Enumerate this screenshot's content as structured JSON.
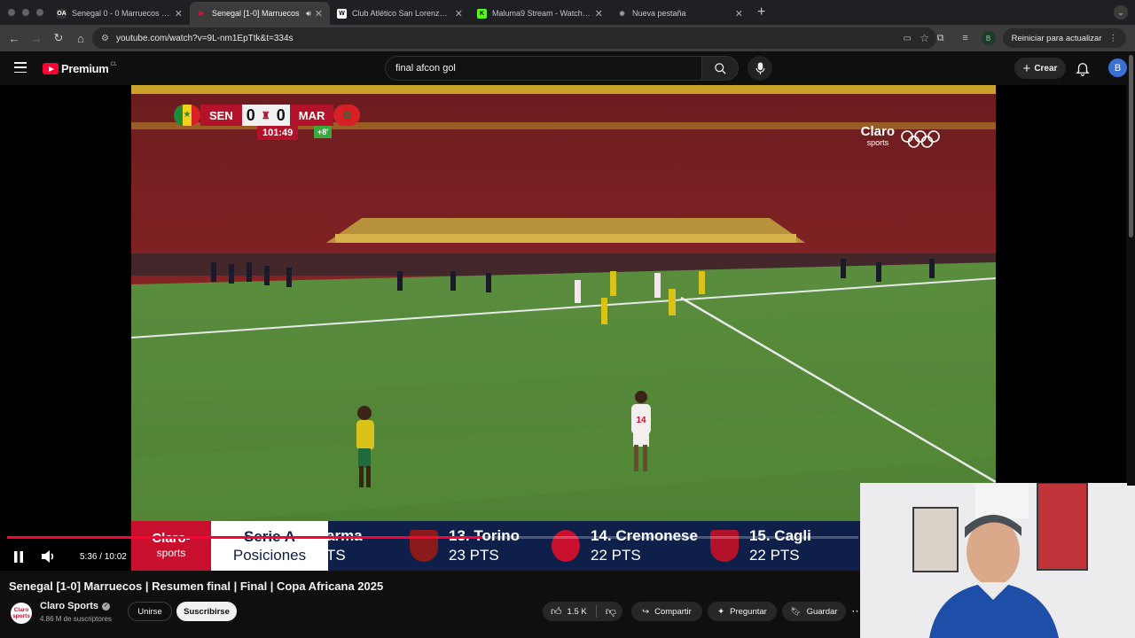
{
  "browser": {
    "tabs": [
      {
        "title": "Senegal 0 - 0 Marruecos (18/",
        "favicon": "OA",
        "favicon_color": "#333333",
        "active": false
      },
      {
        "title": "Senegal [1-0] Marruecos",
        "favicon": "▶",
        "favicon_color": "#ff0033",
        "active": true,
        "audio": true
      },
      {
        "title": "Club Atlético San Lorenzo de",
        "favicon": "W",
        "favicon_color": "#ffffff",
        "active": false
      },
      {
        "title": "Maluma9 Stream - Watch Liv",
        "favicon": "K",
        "favicon_color": "#53fc18",
        "active": false
      },
      {
        "title": "Nueva pestaña",
        "favicon": "◉",
        "favicon_color": "#9aa0a6",
        "active": false
      }
    ],
    "url": "youtube.com/watch?v=9L-nm1EpTtk&t=334s",
    "profile_letter": "B",
    "restart_label": "Reiniciar para actualizar"
  },
  "youtube": {
    "logo_text": "Premium",
    "country_code": "CL",
    "search_value": "final afcon gol",
    "create_label": "Crear",
    "avatar_letter": "B"
  },
  "video": {
    "scorebug": {
      "home": "SEN",
      "away": "MAR",
      "home_score": "0",
      "away_score": "0",
      "clock": "101:49",
      "added_time": "+8'"
    },
    "watermark": {
      "brand": "Claro",
      "sub": "sports"
    },
    "ticker": {
      "brand": "Claro-",
      "brand_sub": "sports",
      "title_top": "Serie A",
      "title_bottom": "Posiciones",
      "items": [
        {
          "name": "arma",
          "pts": "TS",
          "crest_color": "#ffffff"
        },
        {
          "name": "13. Torino",
          "pts": "23 PTS",
          "crest_color": "#8b1a1a"
        },
        {
          "name": "14. Cremonese",
          "pts": "22 PTS",
          "crest_color": "#c8102e"
        },
        {
          "name": "15. Cagli",
          "pts": "22 PTS",
          "crest_color": "#b3122b"
        }
      ]
    },
    "progress": 0.557,
    "time": "5:36 / 10:02"
  },
  "meta": {
    "title": "Senegal [1-0] Marruecos | Resumen final | Final | Copa Africana 2025",
    "channel": "Claro Sports",
    "channel_avatar": "Claro sports",
    "subscribers": "4.86 M de suscriptores",
    "join_label": "Unirse",
    "subscribe_label": "Suscribirse",
    "likes": "1.5 K",
    "share_label": "Compartir",
    "ask_label": "Preguntar",
    "save_label": "Guardar"
  },
  "colors": {
    "accent": "#ff0033",
    "pitch": "#4f8a3a",
    "ticker_bg": "#0e1f4a"
  }
}
